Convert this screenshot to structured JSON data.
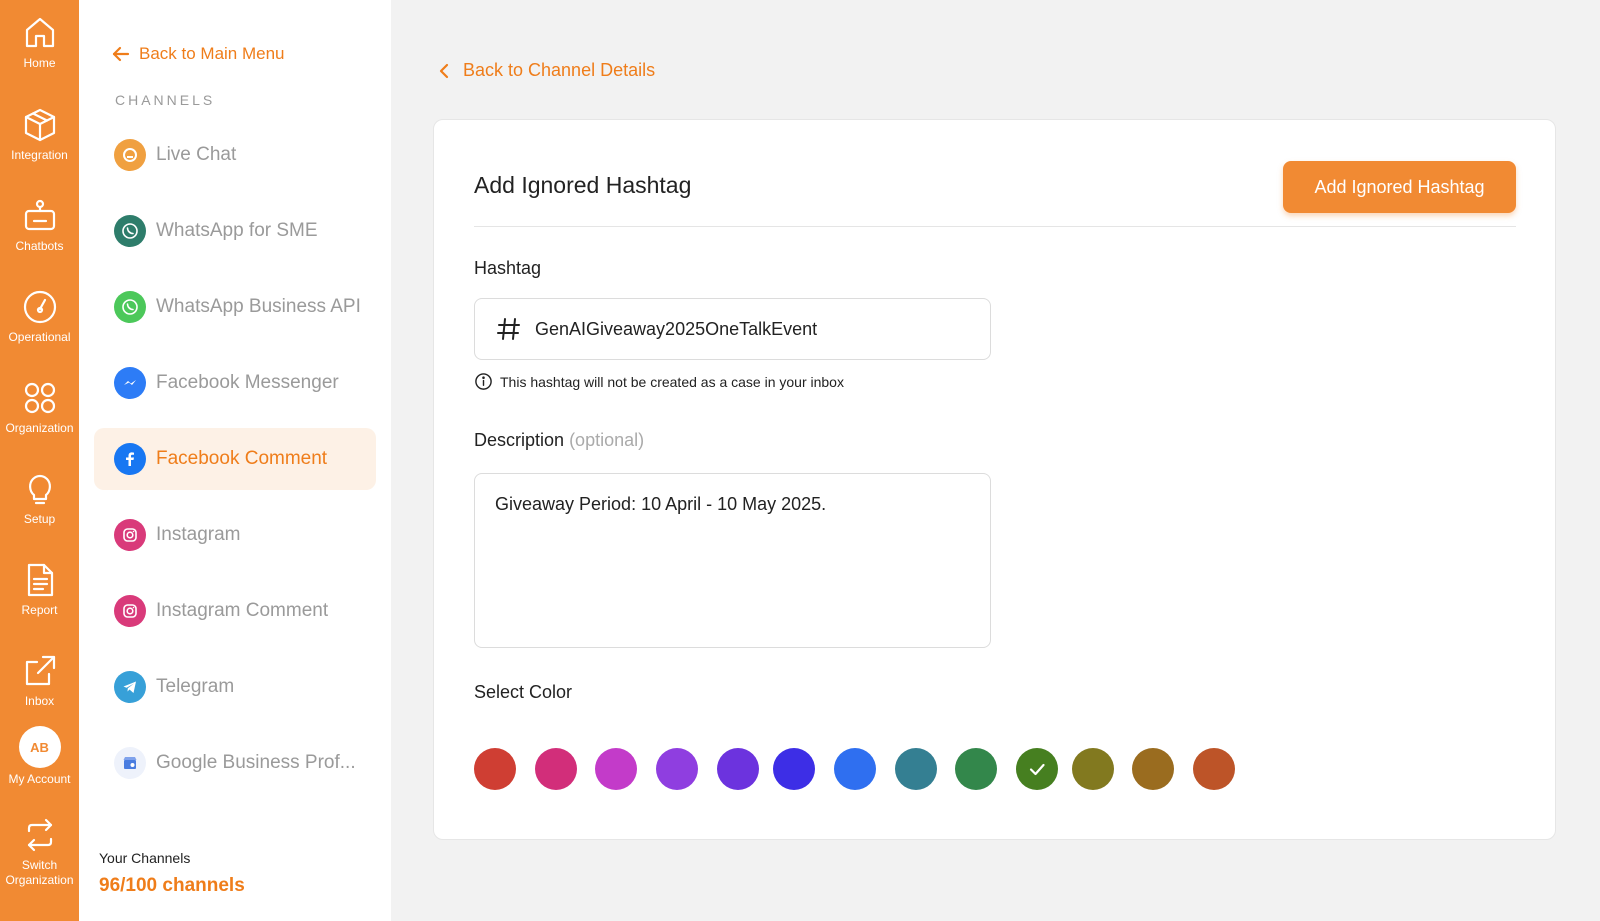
{
  "rail": {
    "items": [
      {
        "label": "Home",
        "icon": "home-icon"
      },
      {
        "label": "Integration",
        "icon": "cube-icon"
      },
      {
        "label": "Chatbots",
        "icon": "robot-icon"
      },
      {
        "label": "Operational",
        "icon": "gauge-icon"
      },
      {
        "label": "Organization",
        "icon": "grid-circles-icon"
      },
      {
        "label": "Setup",
        "icon": "lightbulb-icon"
      },
      {
        "label": "Report",
        "icon": "document-icon"
      },
      {
        "label": "Inbox",
        "icon": "external-link-icon"
      }
    ],
    "account": {
      "initials": "AB",
      "label": "My Account"
    },
    "switch": {
      "label": "Switch Organization",
      "icon": "switch-arrows-icon"
    }
  },
  "sidebar": {
    "back_label": "Back to Main Menu",
    "section_title": "CHANNELS",
    "channels": [
      {
        "label": "Live Chat",
        "icon": "live-chat-icon",
        "color": "#f0a040"
      },
      {
        "label": "WhatsApp for SME",
        "icon": "whatsapp-icon",
        "color": "#2e7d6b"
      },
      {
        "label": "WhatsApp Business API",
        "icon": "whatsapp-icon",
        "color": "#4cc85a"
      },
      {
        "label": "Facebook Messenger",
        "icon": "messenger-icon",
        "color": "#2d7cf6"
      },
      {
        "label": "Facebook Comment",
        "icon": "facebook-icon",
        "color": "#1877f2",
        "active": true
      },
      {
        "label": "Instagram",
        "icon": "instagram-icon",
        "color": "#d93a7a"
      },
      {
        "label": "Instagram Comment",
        "icon": "instagram-icon",
        "color": "#d93a7a"
      },
      {
        "label": "Telegram",
        "icon": "telegram-icon",
        "color": "#37a0d8"
      },
      {
        "label": "Google Business Prof...",
        "icon": "google-business-icon",
        "color": "#4a7de0"
      }
    ],
    "your_channels_label": "Your Channels",
    "channel_count": "96/100 channels"
  },
  "main": {
    "back_label": "Back to Channel Details",
    "title": "Add Ignored Hashtag",
    "add_button_label": "Add Ignored Hashtag",
    "hashtag_label": "Hashtag",
    "hashtag_value": "GenAIGiveaway2025OneTalkEvent",
    "hint": "This hashtag will not be created as a case in your inbox",
    "description_label": "Description",
    "description_optional": "(optional)",
    "description_value": "Giveaway Period: 10 April - 10 May 2025.",
    "select_color_label": "Select Color",
    "colors": [
      "#cf3e33",
      "#d22e7a",
      "#c33bc9",
      "#8f3ee0",
      "#6c33de",
      "#3d2ee6",
      "#2f6ff0",
      "#347f92",
      "#33874b",
      "#467f20",
      "#82791f",
      "#9a6c1f",
      "#bd5428"
    ],
    "selected_color_index": 9
  },
  "theme": {
    "accent": "#f18a33",
    "accent_text": "#ef7d1a"
  }
}
